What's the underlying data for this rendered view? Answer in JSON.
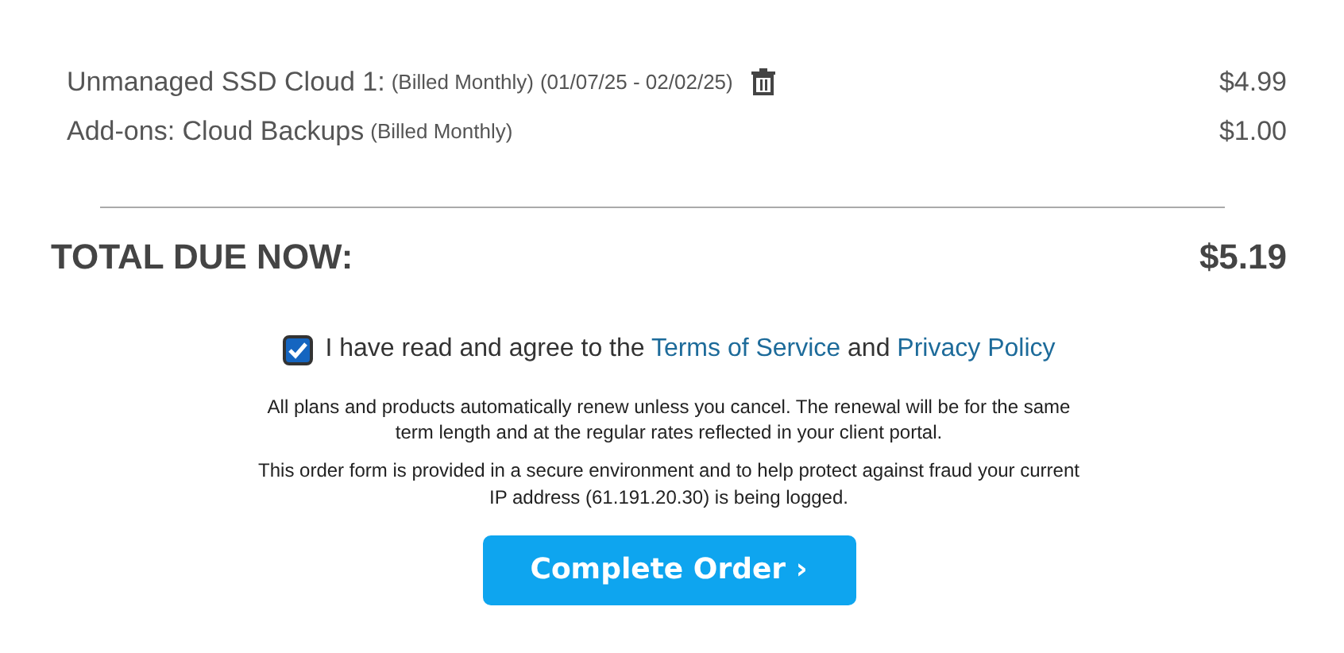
{
  "line_items": [
    {
      "label": "Unmanaged SSD Cloud 1:",
      "notes": [
        "(Billed Monthly)",
        "(01/07/25 - 02/02/25)"
      ],
      "removable": true,
      "price": "$4.99"
    },
    {
      "label": "Add-ons: Cloud Backups",
      "notes": [
        "(Billed Monthly)"
      ],
      "removable": false,
      "price": "$1.00"
    }
  ],
  "total": {
    "label": "TOTAL DUE NOW:",
    "amount": "$5.19"
  },
  "agreement": {
    "checked": true,
    "text": "I have read and agree to the",
    "link_1": "Terms of Service",
    "joiner": "and",
    "link_2": "Privacy Policy"
  },
  "notices": [
    "All plans and products automatically renew unless you cancel. The renewal will be for the same term length and at the regular rates reflected in your client portal.",
    "This order form is provided in a secure environment and to help protect against fraud your current IP address (61.191.20.30) is being logged."
  ],
  "submit": {
    "label": "Complete Order",
    "chevron": "›"
  }
}
